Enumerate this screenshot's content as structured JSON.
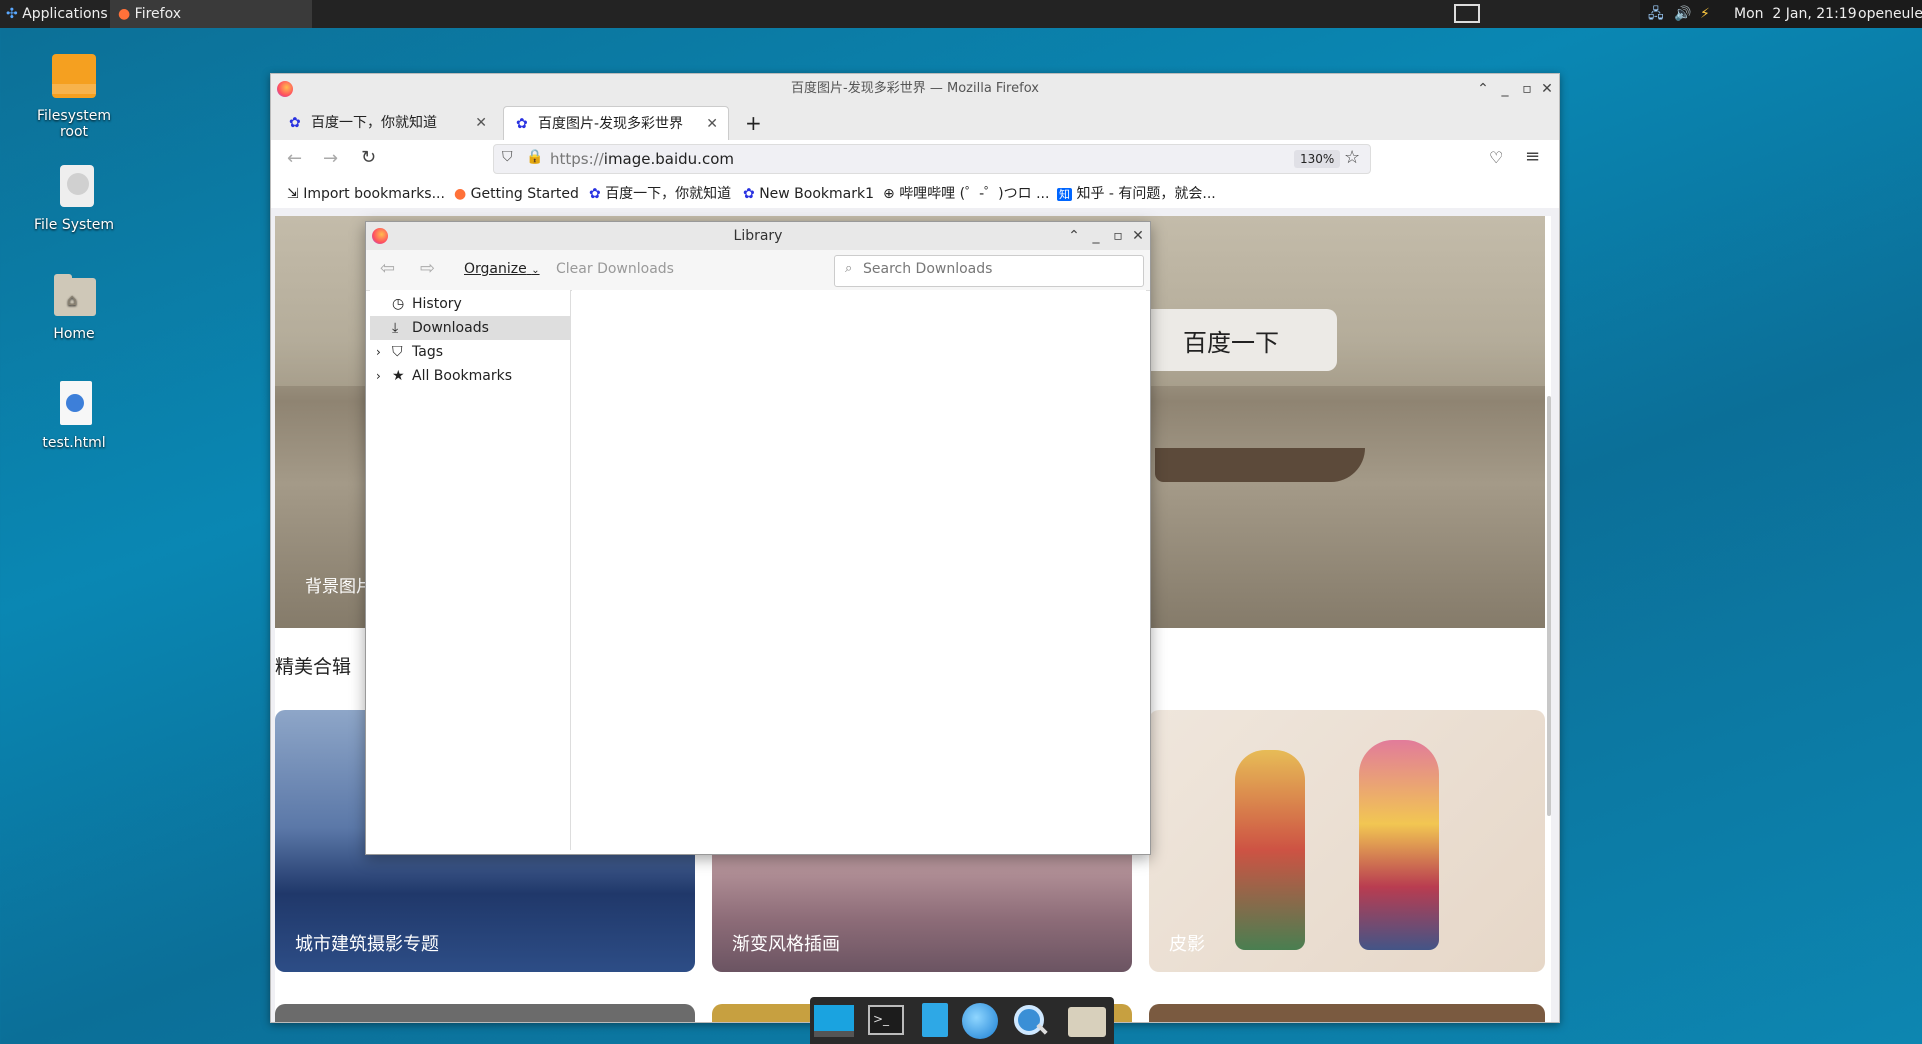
{
  "topbar": {
    "applications": "Applications",
    "task_label": "Firefox",
    "datetime": "Mon  2 Jan, 21:19",
    "user": "openeuler"
  },
  "desktop": {
    "icons": [
      {
        "label": "Filesystem\nroot"
      },
      {
        "label": "File System"
      },
      {
        "label": "Home"
      },
      {
        "label": "test.html"
      }
    ]
  },
  "firefox": {
    "window_title": "百度图片-发现多彩世界 — Mozilla Firefox",
    "tabs": [
      {
        "label": "百度一下，你就知道"
      },
      {
        "label": "百度图片-发现多彩世界"
      }
    ],
    "url_prefix": "https://",
    "url_host": "image.baidu.com",
    "zoom": "130%",
    "bookmarks": [
      "Import bookmarks...",
      "Getting Started",
      "百度一下，你就知道",
      "New Bookmark1",
      "哔哩哔哩 (゜-゜)つロ ...",
      "知乎 - 有问题，就会..."
    ]
  },
  "page": {
    "search_button": "百度一下",
    "bg_caption": "背景图片",
    "section_title": "精美合辑",
    "cards": [
      "城市建筑摄影专题",
      "渐变风格插画",
      "皮影"
    ]
  },
  "library": {
    "title": "Library",
    "organize": "Organize",
    "clear_downloads": "Clear Downloads",
    "search_placeholder": "Search Downloads",
    "sidebar": [
      "History",
      "Downloads",
      "Tags",
      "All Bookmarks"
    ]
  }
}
